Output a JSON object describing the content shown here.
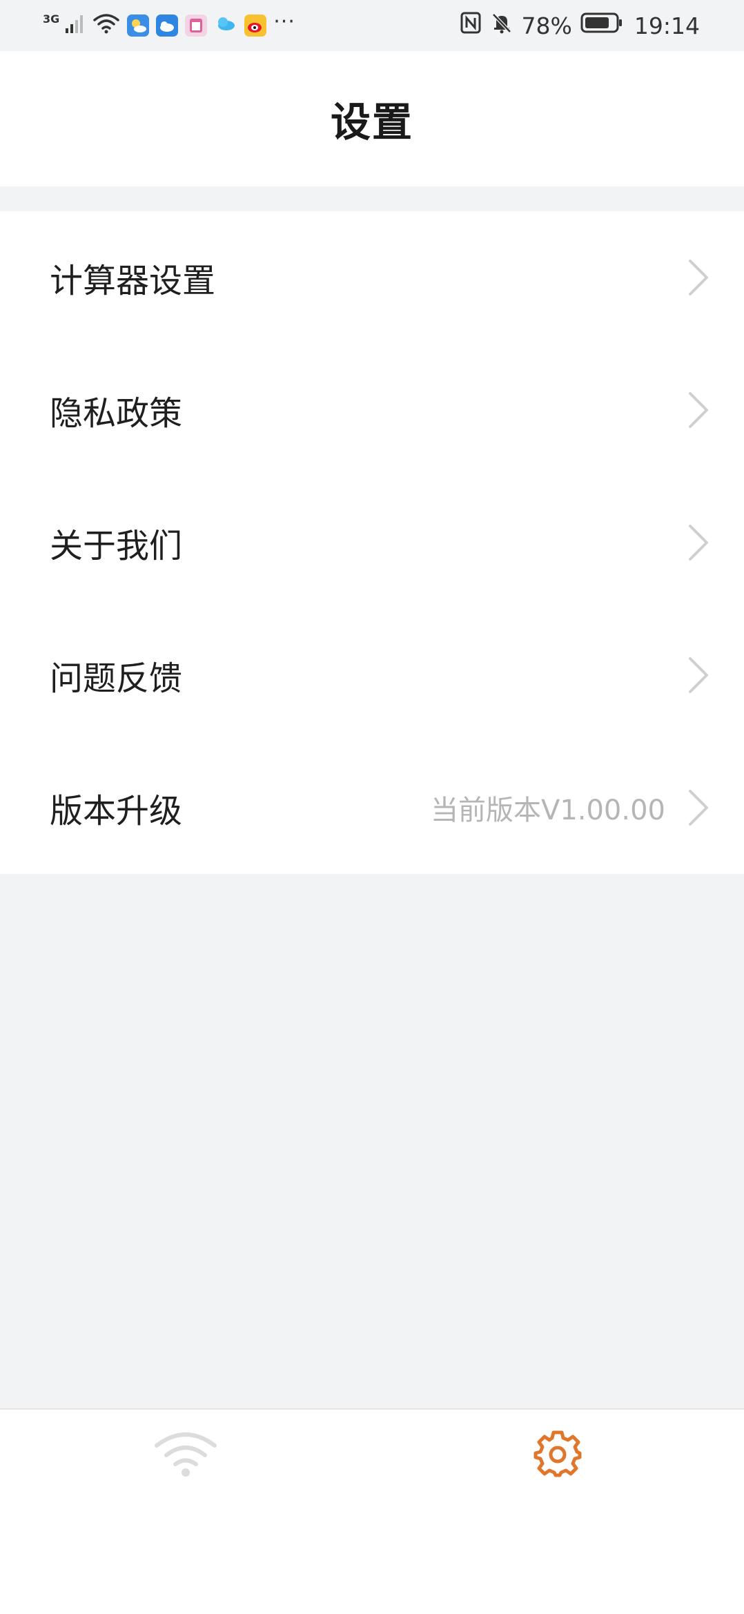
{
  "status_bar": {
    "network": "3G",
    "battery": "78%",
    "time": "19:14",
    "more": "···",
    "icons": [
      "signal-icon",
      "wifi-icon",
      "weather-icon",
      "cloud-icon",
      "calendar-icon",
      "cloud-drive-icon",
      "weibo-icon",
      "nfc-icon",
      "bell-off-icon",
      "battery-icon"
    ]
  },
  "header": {
    "title": "设置"
  },
  "settings": {
    "items": [
      {
        "label": "计算器设置",
        "value": ""
      },
      {
        "label": "隐私政策",
        "value": ""
      },
      {
        "label": "关于我们",
        "value": ""
      },
      {
        "label": "问题反馈",
        "value": ""
      },
      {
        "label": "版本升级",
        "value": "当前版本V1.00.00"
      }
    ]
  },
  "tab_bar": {
    "tabs": [
      {
        "icon": "wifi-icon",
        "active": false
      },
      {
        "icon": "gear-icon",
        "active": true
      }
    ],
    "active_color": "#e0762b",
    "inactive_color": "#d9d9d9"
  }
}
